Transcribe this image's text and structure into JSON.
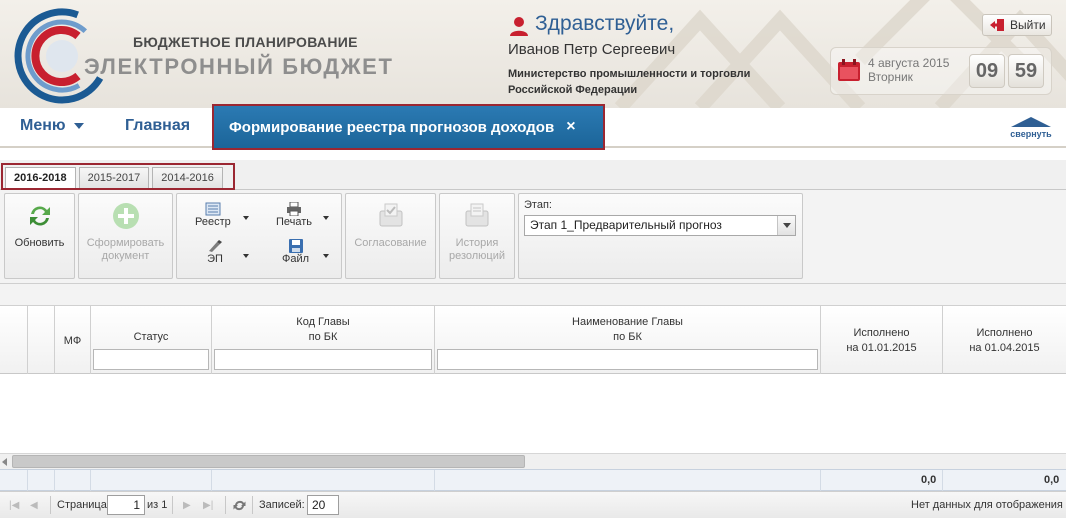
{
  "header": {
    "logo_line1": "БЮДЖЕТНОЕ ПЛАНИРОВАНИЕ",
    "logo_line2": "ЭЛЕКТРОННЫЙ БЮДЖЕТ",
    "greeting": "Здравствуйте,",
    "user_name": "Иванов Петр Сергеевич",
    "ministry": "Министерство промышленности и торговли Российской Федерации",
    "logout_label": "Выйти",
    "date": "4 августа 2015",
    "weekday": "Вторник",
    "hours": "09",
    "minutes": "59"
  },
  "nav": {
    "menu_label": "Меню",
    "home_label": "Главная",
    "active_tab_label": "Формирование реестра прогнозов доходов",
    "active_tab_close": "×",
    "collapse_label": "свернуть"
  },
  "period_tabs": [
    {
      "label": "2016-2018",
      "active": true
    },
    {
      "label": "2015-2017",
      "active": false
    },
    {
      "label": "2014-2016",
      "active": false
    }
  ],
  "toolbar": {
    "refresh_label": "Обновить",
    "form_doc_label": "Сформировать документ",
    "registry_label": "Реестр",
    "print_label": "Печать",
    "ep_label": "ЭП",
    "file_label": "Файл",
    "approval_label": "Согласование",
    "history_label": "История резолюций",
    "stage_label": "Этап:",
    "stage_value": "Этап 1_Предварительный прогноз"
  },
  "grid": {
    "columns": {
      "mf": "МФ",
      "status": "Статус",
      "code_line1": "Код Главы",
      "code_line2": "по БК",
      "name_line1": "Наименование Главы",
      "name_line2": "по БК",
      "exec1_line1": "Исполнено",
      "exec1_line2": "на 01.01.2015",
      "exec2_line1": "Исполнено",
      "exec2_line2": "на 01.04.2015"
    },
    "summary": {
      "exec1": "0,0",
      "exec2": "0,0"
    }
  },
  "pager": {
    "page_label": "Страница",
    "page_value": "1",
    "of_label": "из 1",
    "records_label": "Записей:",
    "records_value": "20",
    "no_data": "Нет данных для отображения"
  },
  "colors": {
    "accent_blue": "#2f5f94",
    "highlight_red": "#9b2732",
    "active_tab_bg": "#1c6599"
  }
}
